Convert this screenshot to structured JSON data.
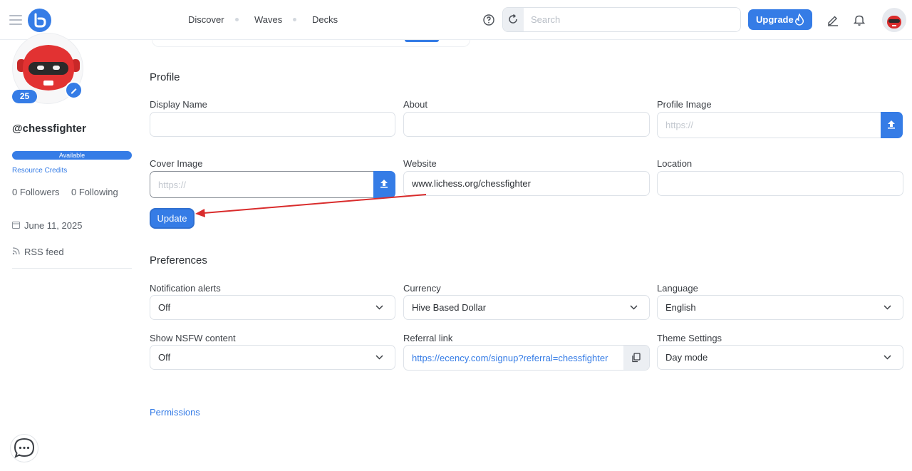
{
  "header": {
    "nav": [
      "Discover",
      "Waves",
      "Decks"
    ],
    "search_placeholder": "Search",
    "upgrade_label": "Upgrade"
  },
  "sidebar": {
    "reputation": "25",
    "username": "@chessfighter",
    "rc_status": "Available",
    "rc_percent": 100,
    "rc_link": "Resource Credits",
    "followers": "0 Followers",
    "following": "0 Following",
    "created": "June 11, 2025",
    "rss": "RSS feed"
  },
  "profile": {
    "title": "Profile",
    "display_name_label": "Display Name",
    "display_name_value": "",
    "about_label": "About",
    "about_value": "",
    "profile_image_label": "Profile Image",
    "profile_image_placeholder": "https://",
    "cover_image_label": "Cover Image",
    "cover_image_placeholder": "https://",
    "website_label": "Website",
    "website_value": "www.lichess.org/chessfighter",
    "location_label": "Location",
    "location_value": "",
    "update_label": "Update"
  },
  "preferences": {
    "title": "Preferences",
    "notification_label": "Notification alerts",
    "notification_value": "Off",
    "currency_label": "Currency",
    "currency_value": "Hive Based Dollar",
    "language_label": "Language",
    "language_value": "English",
    "nsfw_label": "Show NSFW content",
    "nsfw_value": "Off",
    "referral_label": "Referral link",
    "referral_value": "https://ecency.com/signup?referral=chessfighter",
    "theme_label": "Theme Settings",
    "theme_value": "Day mode"
  },
  "permissions_link": "Permissions",
  "colors": {
    "accent": "#357ce6",
    "annotation_arrow": "#d92c2c"
  },
  "icons": [
    "menu-icon",
    "logo-icon",
    "help-icon",
    "refresh-icon",
    "fire-icon",
    "edit-icon",
    "bell-icon",
    "pencil-icon",
    "calendar-icon",
    "rss-icon",
    "upload-icon",
    "chevron-down-icon",
    "copy-icon",
    "chat-icon"
  ]
}
